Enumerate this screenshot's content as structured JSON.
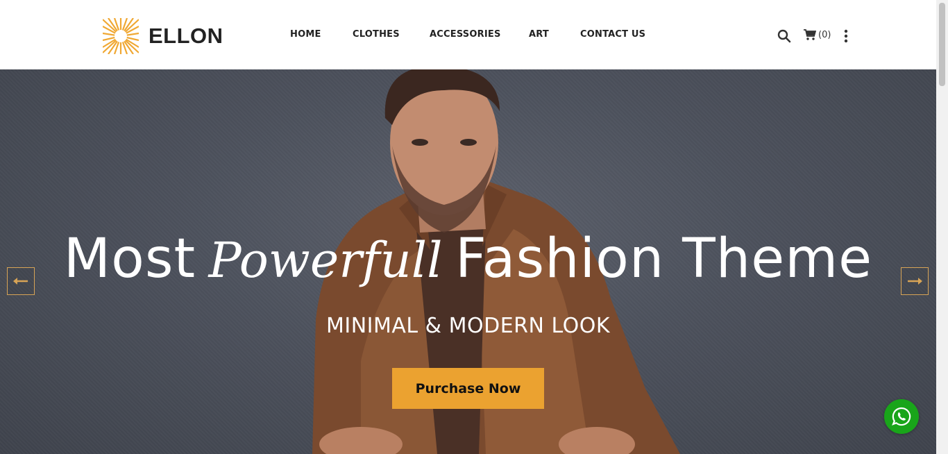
{
  "brand": {
    "name": "ELLON",
    "logo_icon": "sunburst-logo-icon",
    "logo_color": "#f0a833"
  },
  "nav": {
    "items": [
      {
        "label": "HOME"
      },
      {
        "label": "CLOTHES"
      },
      {
        "label": "ACCESSORIES"
      },
      {
        "label": "ART"
      },
      {
        "label": "CONTACT US"
      }
    ]
  },
  "tools": {
    "search_icon": "search-icon",
    "cart_icon": "cart-icon",
    "cart_count": "(0)",
    "more_icon": "vertical-dots-icon"
  },
  "hero": {
    "title_part1": "Most",
    "title_script": "Powerfull",
    "title_part2": "Fashion Theme",
    "subtitle": "MINIMAL & MODERN LOOK",
    "cta_label": "Purchase Now",
    "prev_icon": "arrow-left-icon",
    "next_icon": "arrow-right-icon"
  },
  "floating": {
    "whatsapp_icon": "whatsapp-icon"
  },
  "colors": {
    "accent": "#eba230",
    "whatsapp": "#19a51a",
    "text_dark": "#222222"
  }
}
